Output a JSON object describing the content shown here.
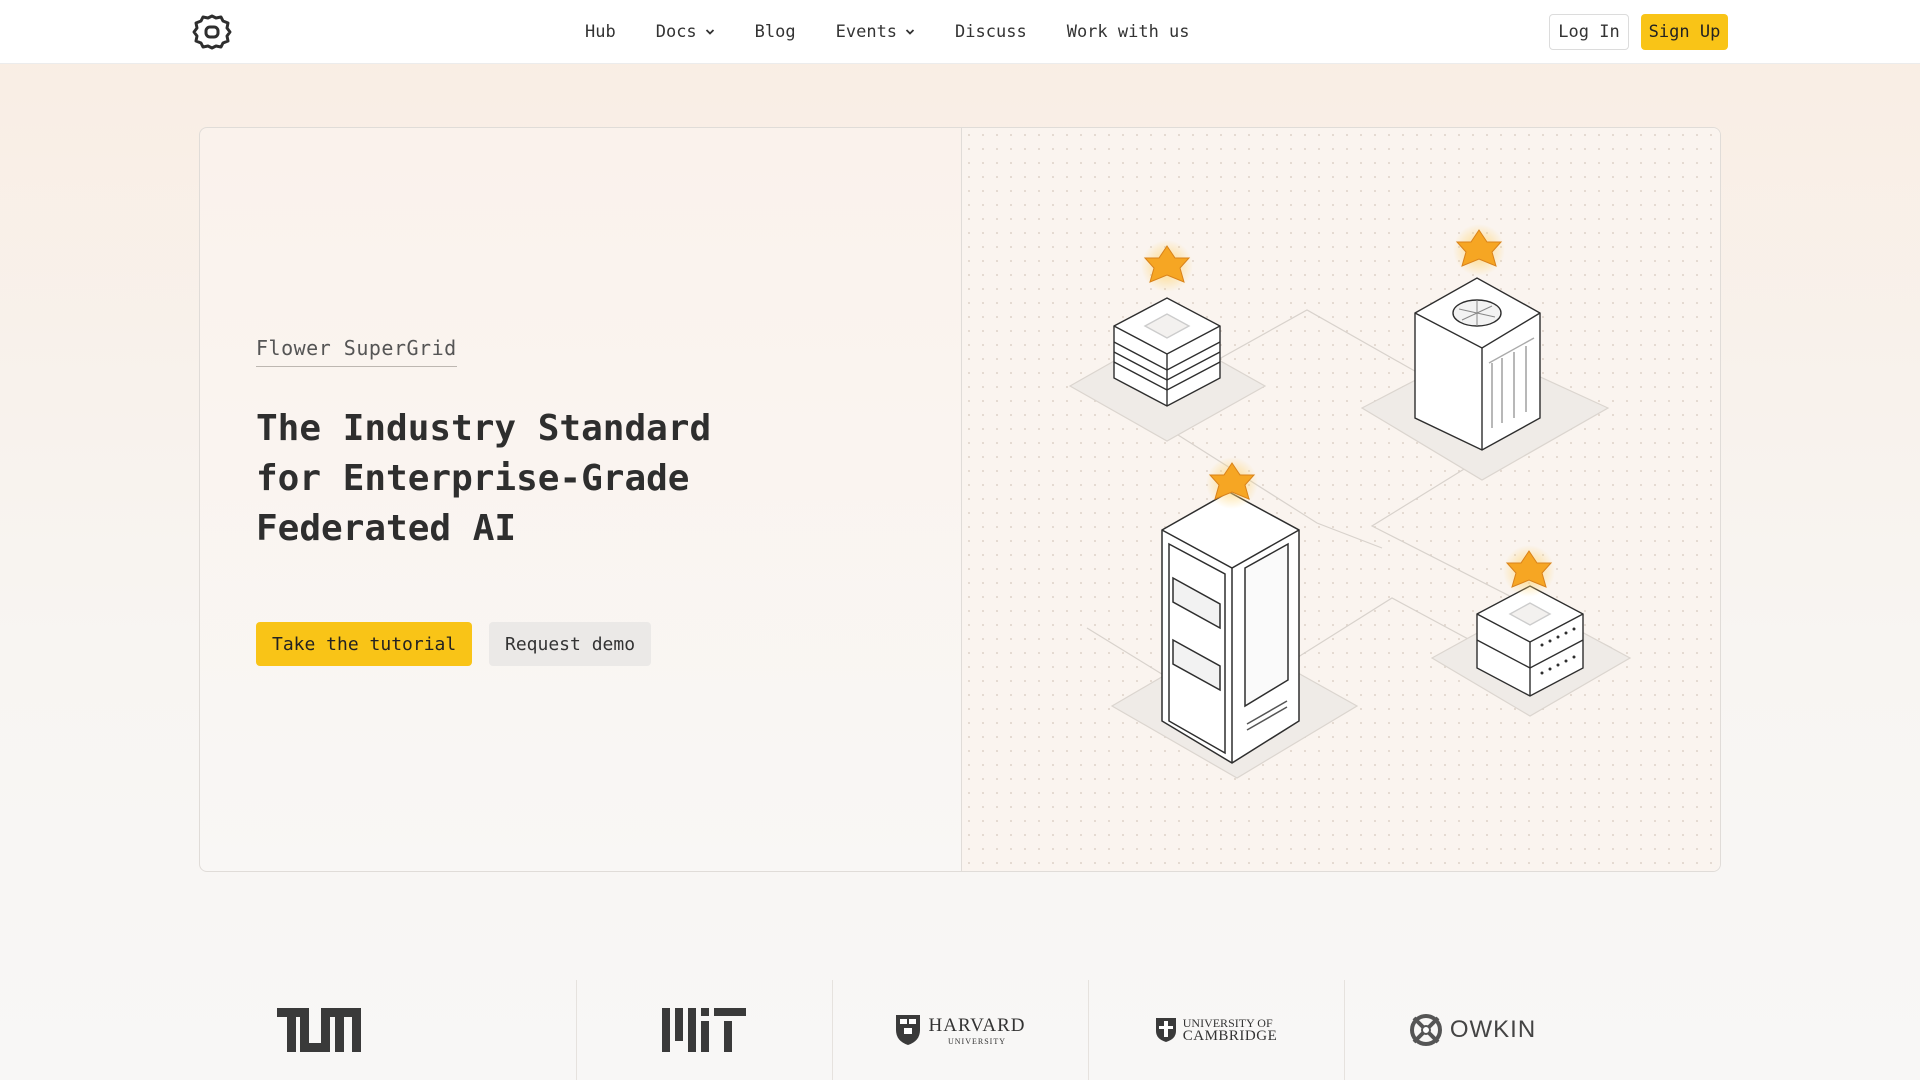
{
  "nav": {
    "logo_icon": "flower-logo-icon",
    "links": [
      {
        "label": "Hub",
        "dropdown": false
      },
      {
        "label": "Docs",
        "dropdown": true
      },
      {
        "label": "Blog",
        "dropdown": false
      },
      {
        "label": "Events",
        "dropdown": true
      },
      {
        "label": "Discuss",
        "dropdown": false
      },
      {
        "label": "Work with us",
        "dropdown": false
      }
    ],
    "login_label": "Log In",
    "signup_label": "Sign Up"
  },
  "hero": {
    "eyebrow": "Flower SuperGrid",
    "headline_line1": "The Industry Standard",
    "headline_line2": "for Enterprise-Grade",
    "headline_line3": "Federated AI",
    "primary_button": "Take the tutorial",
    "secondary_button": "Request demo"
  },
  "partners": [
    {
      "name": "TUM",
      "style": "tum-logo"
    },
    {
      "name": "MIT",
      "style": "mit-logo"
    },
    {
      "name": "HARVARD",
      "sub": "UNIVERSITY",
      "style": "harvard-logo"
    },
    {
      "name": "UNIVERSITY OF",
      "sub": "CAMBRIDGE",
      "style": "cambridge-logo"
    },
    {
      "name": "OWKIN",
      "style": "owkin-logo"
    }
  ],
  "colors": {
    "accent": "#f9c417",
    "text": "#2e2e2e",
    "hero_bg": "#faf2ec"
  }
}
